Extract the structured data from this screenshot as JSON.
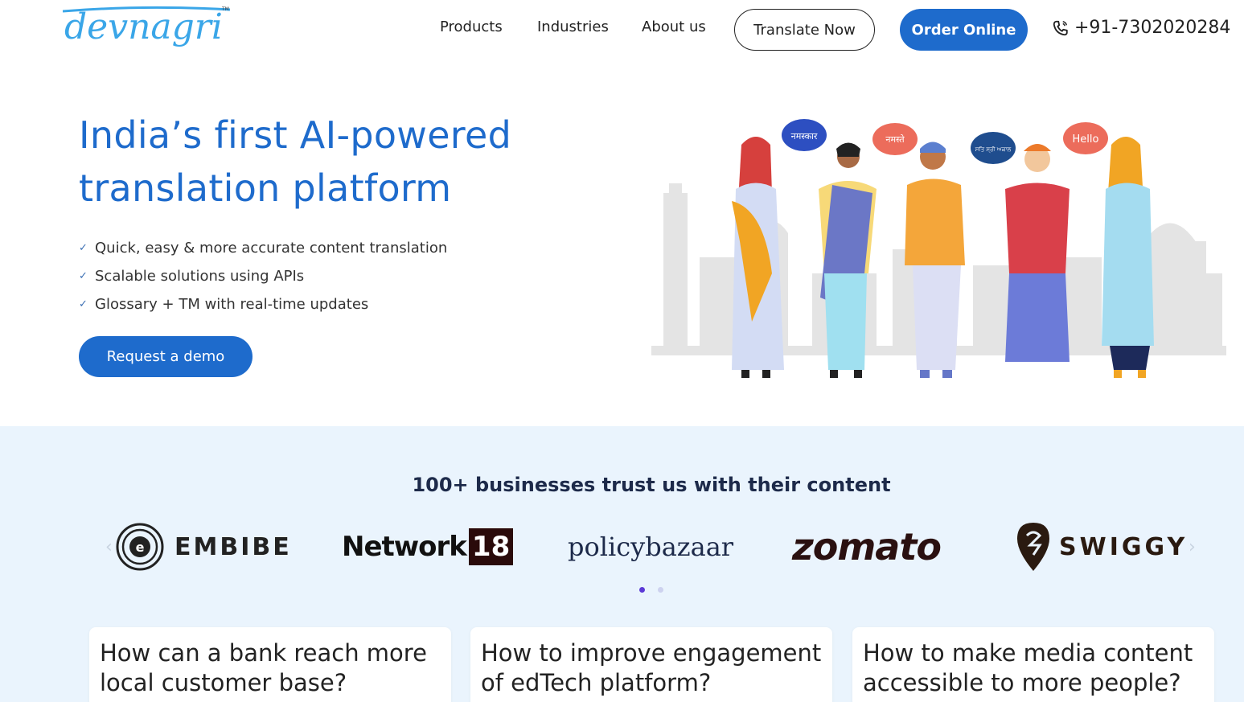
{
  "header": {
    "logo_text": "devnagri",
    "logo_tm": "TM",
    "nav": [
      "Products",
      "Industries",
      "About us"
    ],
    "translate_label": "Translate Now",
    "order_label": "Order Online",
    "phone": "+91-7302020284",
    "phone_icon": "phone-icon"
  },
  "hero": {
    "title_line1": "India’s first AI-powered",
    "title_line2": "translation platform",
    "bullets": [
      "Quick, easy & more accurate content translation",
      "Scalable solutions using APIs",
      "Glossary + TM with real-time updates"
    ],
    "cta_label": "Request a demo",
    "speech": [
      "नमस्कार",
      "नमस्ते",
      "ਸਤਿ ਸ੍ਰੀ ਅਕਾਲ",
      "Hello"
    ]
  },
  "trust": {
    "title": "100+ businesses trust us with their content",
    "logos": {
      "embibe": "EMBIBE",
      "network": "Network",
      "network_num": "18",
      "policybazaar": "policybazaar",
      "zomato": "zomato",
      "swiggy": "SWIGGY"
    },
    "arrows": [
      "‹",
      "›"
    ],
    "active_slide": 1,
    "slides": 2
  },
  "cards": [
    "How can a bank reach more local customer base?",
    "How to improve engagement of edTech platform?",
    "How to make media content accessible to more people?"
  ],
  "colors": {
    "brand_blue": "#1e6bcc",
    "section_bg": "#eaf4fd"
  }
}
